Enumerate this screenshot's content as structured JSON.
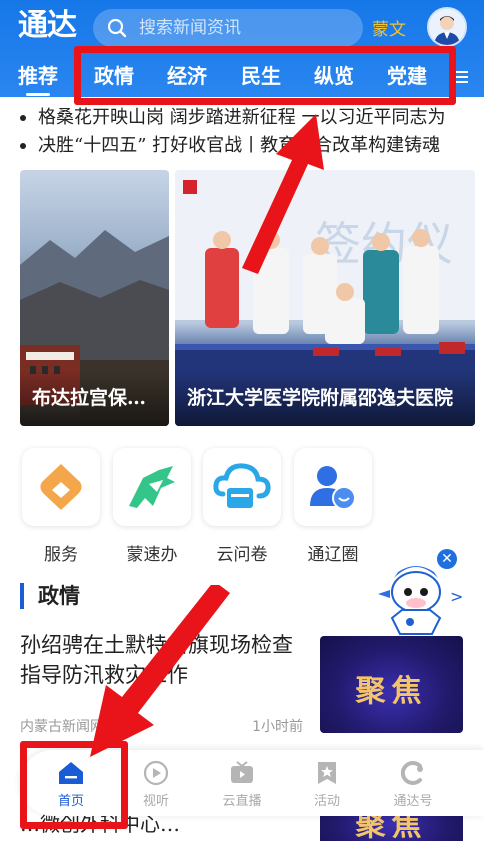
{
  "header": {
    "logo_text": "通达",
    "search_placeholder": "搜索新闻资讯",
    "language_toggle": "蒙文"
  },
  "tabs": [
    {
      "label": "推荐",
      "active": true
    },
    {
      "label": "政情",
      "active": false
    },
    {
      "label": "经济",
      "active": false
    },
    {
      "label": "民生",
      "active": false
    },
    {
      "label": "纵览",
      "active": false
    },
    {
      "label": "党建",
      "active": false
    }
  ],
  "headlines": [
    "格桑花开映山岗 阔步踏进新征程 一以习近平同志为",
    "决胜“十四五” 打好收官战丨教育综合改革构建铸魂"
  ],
  "carousel": {
    "slides": [
      {
        "caption": "布达拉宫保…"
      },
      {
        "caption": "浙江大学医学院附属邵逸夫医院"
      }
    ]
  },
  "services": [
    {
      "label": "服务",
      "icon": "service-icon"
    },
    {
      "label": "蒙速办",
      "icon": "horse-icon"
    },
    {
      "label": "云问卷",
      "icon": "cloud-book-icon"
    },
    {
      "label": "通辽圈",
      "icon": "people-chat-icon"
    }
  ],
  "section": {
    "title": "政情",
    "news": [
      {
        "title": "孙绍骋在土默特右旗现场检查指导防汛救灾工作",
        "source": "内蒙古新闻网",
        "time": "1小时前",
        "thumb_text": "聚焦"
      },
      {
        "title": "…微创外科中心…",
        "thumb_text": "聚焦"
      }
    ]
  },
  "bottom_nav": [
    {
      "label": "首页",
      "icon": "home-icon",
      "active": true
    },
    {
      "label": "视听",
      "icon": "play-icon",
      "active": false
    },
    {
      "label": "云直播",
      "icon": "tv-icon",
      "active": false
    },
    {
      "label": "活动",
      "icon": "star-icon",
      "active": false
    },
    {
      "label": "通达号",
      "icon": "c-icon",
      "active": false
    }
  ],
  "colors": {
    "brand_blue": "#1677e8",
    "accent_yellow": "#f2c230",
    "annotation_red": "#e8141a",
    "active_nav": "#1a5bd6"
  }
}
